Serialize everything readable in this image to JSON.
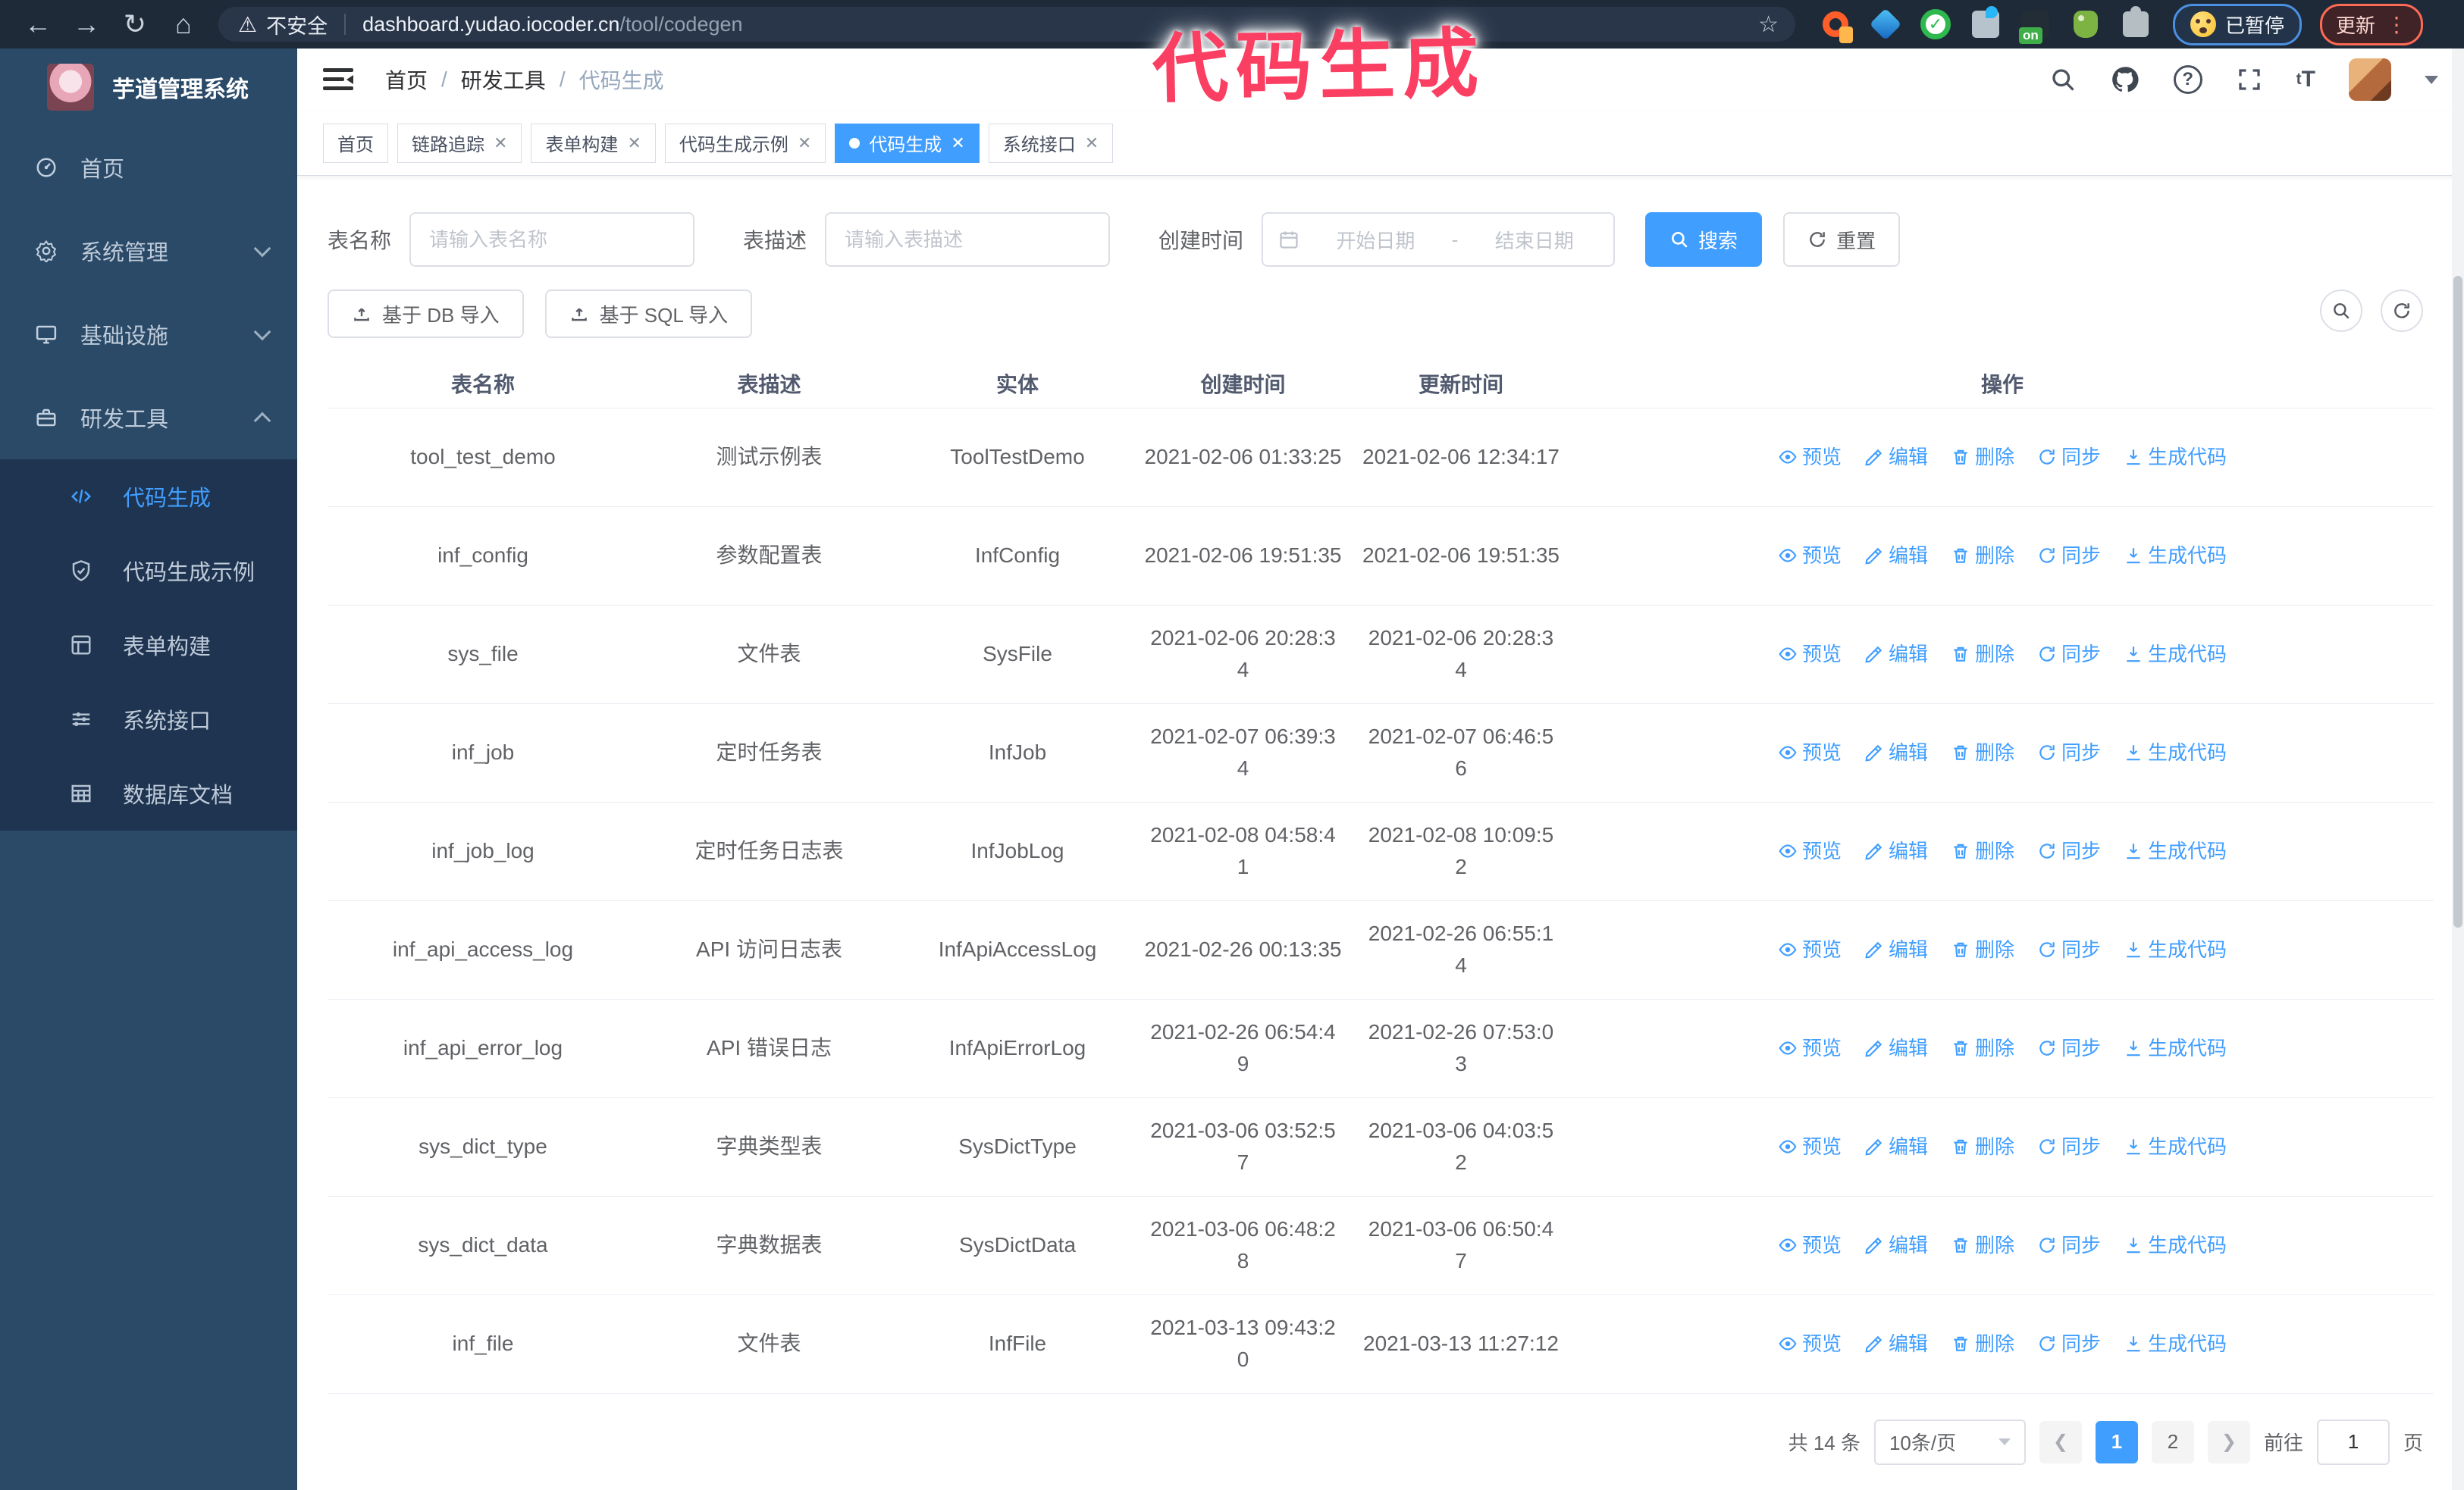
{
  "browser": {
    "security_warning": "不安全",
    "url_host": "dashboard.yudao.iocoder.cn",
    "url_path": "/tool/codegen",
    "paused_badge": "已暂停",
    "update_button": "更新"
  },
  "annotation": {
    "text": "代码生成",
    "color": "#fb3f63"
  },
  "sidebar": {
    "logo_title": "芋道管理系统",
    "items": [
      {
        "label": "首页",
        "icon": "dashboard-icon"
      },
      {
        "label": "系统管理",
        "icon": "gear-icon",
        "state": "collapsed"
      },
      {
        "label": "基础设施",
        "icon": "monitor-icon",
        "state": "collapsed"
      },
      {
        "label": "研发工具",
        "icon": "toolbox-icon",
        "state": "expanded"
      }
    ],
    "submenu": [
      {
        "label": "代码生成",
        "icon": "code-icon",
        "active": true
      },
      {
        "label": "代码生成示例",
        "icon": "example-icon"
      },
      {
        "label": "表单构建",
        "icon": "form-icon"
      },
      {
        "label": "系统接口",
        "icon": "api-icon"
      },
      {
        "label": "数据库文档",
        "icon": "database-icon"
      }
    ]
  },
  "header": {
    "breadcrumb": [
      "首页",
      "研发工具",
      "代码生成"
    ],
    "separator": "/"
  },
  "tabs": [
    {
      "label": "首页",
      "closable": false
    },
    {
      "label": "链路追踪",
      "closable": true
    },
    {
      "label": "表单构建",
      "closable": true
    },
    {
      "label": "代码生成示例",
      "closable": true
    },
    {
      "label": "代码生成",
      "closable": true,
      "active": true
    },
    {
      "label": "系统接口",
      "closable": true
    }
  ],
  "filters": {
    "table_name_label": "表名称",
    "table_name_placeholder": "请输入表名称",
    "table_desc_label": "表描述",
    "table_desc_placeholder": "请输入表描述",
    "create_time_label": "创建时间",
    "date_start_placeholder": "开始日期",
    "date_separator": "-",
    "date_end_placeholder": "结束日期",
    "search_label": "搜索",
    "reset_label": "重置"
  },
  "toolbar": {
    "import_db_label": "基于 DB 导入",
    "import_sql_label": "基于 SQL 导入"
  },
  "table": {
    "columns": [
      "表名称",
      "表描述",
      "实体",
      "创建时间",
      "更新时间",
      "操作"
    ],
    "actions": [
      {
        "label": "预览",
        "icon": "eye-icon"
      },
      {
        "label": "编辑",
        "icon": "pencil-icon"
      },
      {
        "label": "删除",
        "icon": "trash-icon"
      },
      {
        "label": "同步",
        "icon": "sync-icon"
      },
      {
        "label": "生成代码",
        "icon": "download-icon"
      }
    ],
    "rows": [
      {
        "name": "tool_test_demo",
        "desc": "测试示例表",
        "entity": "ToolTestDemo",
        "created": "2021-02-06 01:33:25",
        "updated": "2021-02-06 12:34:17"
      },
      {
        "name": "inf_config",
        "desc": "参数配置表",
        "entity": "InfConfig",
        "created": "2021-02-06 19:51:35",
        "updated": "2021-02-06 19:51:35"
      },
      {
        "name": "sys_file",
        "desc": "文件表",
        "entity": "SysFile",
        "created": "2021-02-06 20:28:3\n4",
        "updated": "2021-02-06 20:28:3\n4"
      },
      {
        "name": "inf_job",
        "desc": "定时任务表",
        "entity": "InfJob",
        "created": "2021-02-07 06:39:3\n4",
        "updated": "2021-02-07 06:46:5\n6"
      },
      {
        "name": "inf_job_log",
        "desc": "定时任务日志表",
        "entity": "InfJobLog",
        "created": "2021-02-08 04:58:4\n1",
        "updated": "2021-02-08 10:09:5\n2"
      },
      {
        "name": "inf_api_access_log",
        "desc": "API 访问日志表",
        "entity": "InfApiAccessLog",
        "created": "2021-02-26 00:13:35",
        "updated": "2021-02-26 06:55:1\n4"
      },
      {
        "name": "inf_api_error_log",
        "desc": "API 错误日志",
        "entity": "InfApiErrorLog",
        "created": "2021-02-26 06:54:4\n9",
        "updated": "2021-02-26 07:53:0\n3"
      },
      {
        "name": "sys_dict_type",
        "desc": "字典类型表",
        "entity": "SysDictType",
        "created": "2021-03-06 03:52:5\n7",
        "updated": "2021-03-06 04:03:5\n2"
      },
      {
        "name": "sys_dict_data",
        "desc": "字典数据表",
        "entity": "SysDictData",
        "created": "2021-03-06 06:48:2\n8",
        "updated": "2021-03-06 06:50:4\n7"
      },
      {
        "name": "inf_file",
        "desc": "文件表",
        "entity": "InfFile",
        "created": "2021-03-13 09:43:2\n0",
        "updated": "2021-03-13 11:27:12"
      }
    ]
  },
  "pagination": {
    "total": "共 14 条",
    "page_size": "10条/页",
    "pages": [
      "1",
      "2"
    ],
    "active_page": "1",
    "goto_label": "前往",
    "goto_value": "1",
    "goto_suffix": "页"
  },
  "colors": {
    "primary": "#409eff",
    "sidebar_bg": "#2a4a68",
    "submenu_bg": "#1e3450",
    "chrome_bg": "#1e2a38",
    "annotation": "#fb3f63"
  }
}
